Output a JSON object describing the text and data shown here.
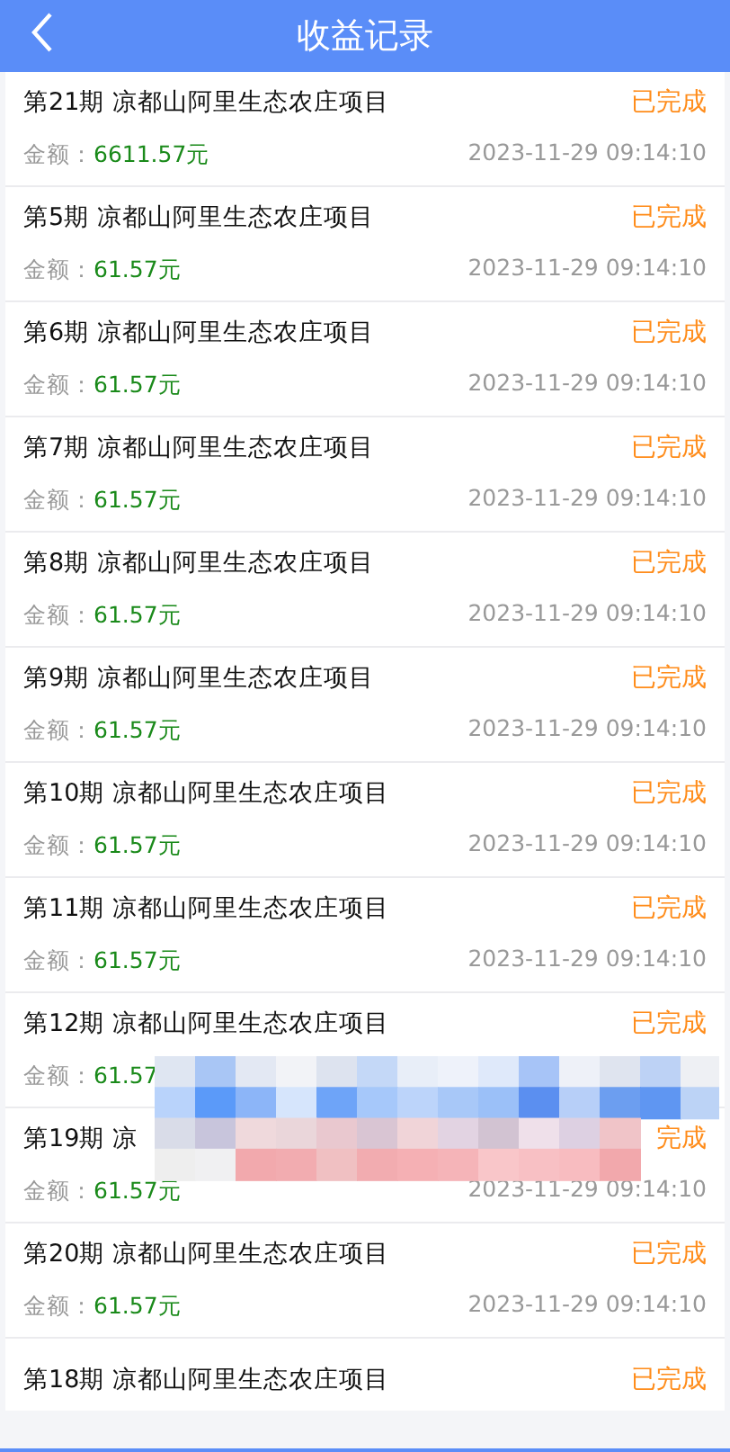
{
  "header": {
    "title": "收益记录"
  },
  "records": [
    {
      "title": "第21期 凉都山阿里生态农庄项目",
      "status": "已完成",
      "amount_label": "金额：",
      "amount": "6611.57元",
      "time": "2023-11-29 09:14:10"
    },
    {
      "title": "第5期 凉都山阿里生态农庄项目",
      "status": "已完成",
      "amount_label": "金额：",
      "amount": "61.57元",
      "time": "2023-11-29 09:14:10"
    },
    {
      "title": "第6期 凉都山阿里生态农庄项目",
      "status": "已完成",
      "amount_label": "金额：",
      "amount": "61.57元",
      "time": "2023-11-29 09:14:10"
    },
    {
      "title": "第7期 凉都山阿里生态农庄项目",
      "status": "已完成",
      "amount_label": "金额：",
      "amount": "61.57元",
      "time": "2023-11-29 09:14:10"
    },
    {
      "title": "第8期 凉都山阿里生态农庄项目",
      "status": "已完成",
      "amount_label": "金额：",
      "amount": "61.57元",
      "time": "2023-11-29 09:14:10"
    },
    {
      "title": "第9期 凉都山阿里生态农庄项目",
      "status": "已完成",
      "amount_label": "金额：",
      "amount": "61.57元",
      "time": "2023-11-29 09:14:10"
    },
    {
      "title": "第10期 凉都山阿里生态农庄项目",
      "status": "已完成",
      "amount_label": "金额：",
      "amount": "61.57元",
      "time": "2023-11-29 09:14:10"
    },
    {
      "title": "第11期 凉都山阿里生态农庄项目",
      "status": "已完成",
      "amount_label": "金额：",
      "amount": "61.57元",
      "time": "2023-11-29 09:14:10"
    },
    {
      "title": "第12期 凉都山阿里生态农庄项目",
      "status": "已完成",
      "amount_label": "金额：",
      "amount": "61.57"
    },
    {
      "title": "第19期 凉",
      "status": "完成",
      "amount_label": "金额：",
      "amount": "61.57元",
      "time": "2023-11-29 09:14:10"
    },
    {
      "title": "第20期 凉都山阿里生态农庄项目",
      "status": "已完成",
      "amount_label": "金额：",
      "amount": "61.57元",
      "time": "2023-11-29 09:14:10"
    },
    {
      "title": "第18期 凉都山阿里生态农庄项目",
      "status": "已完成"
    }
  ]
}
